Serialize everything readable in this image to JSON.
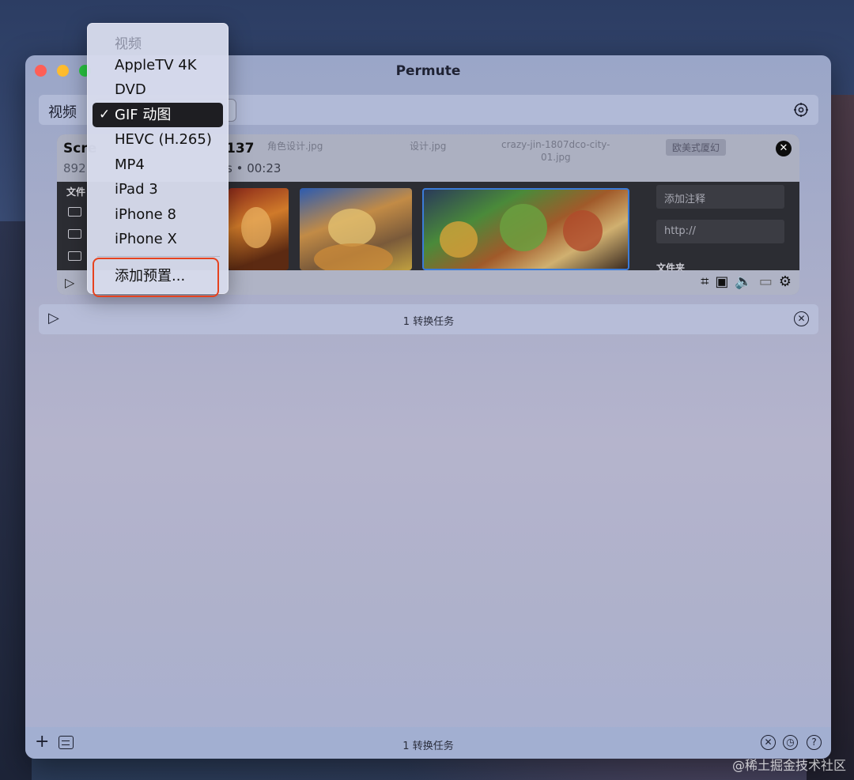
{
  "window": {
    "title": "Permute"
  },
  "toolbar": {
    "category_label": "视频"
  },
  "menu": {
    "header": "视频",
    "items": [
      {
        "label": "AppleTV 4K",
        "selected": false
      },
      {
        "label": "DVD",
        "selected": false
      },
      {
        "label": "GIF 动图",
        "selected": true
      },
      {
        "label": "HEVC (H.265)",
        "selected": false
      },
      {
        "label": "MP4",
        "selected": false
      },
      {
        "label": "iPad 3",
        "selected": false
      },
      {
        "label": "iPhone 8",
        "selected": false
      },
      {
        "label": "iPhone X",
        "selected": false
      }
    ],
    "add_preset": "添加预置...",
    "check_glyph": "✓"
  },
  "card": {
    "title_start": "Scre",
    "title_end": "137",
    "meta_start": "892",
    "meta_end": "s • 00:23",
    "ghost_files": [
      "角色设计.jpg",
      "设计.jpg",
      "crazy-jin-1807dco-city-",
      "01.jpg"
    ],
    "ghost_tag": "欧美式厦幻",
    "folder_label": "文件",
    "side_note_placeholder": "添加注释",
    "side_url_placeholder": "http://",
    "side_folder_label": "文件夹"
  },
  "summary": {
    "task_count": "1 转换任务"
  },
  "bottombar": {
    "task_count": "1 转换任务"
  },
  "watermark": "@稀土掘金技术社区",
  "colors": {
    "accent_highlight": "#e6421e",
    "selection": "#1e1e22"
  }
}
